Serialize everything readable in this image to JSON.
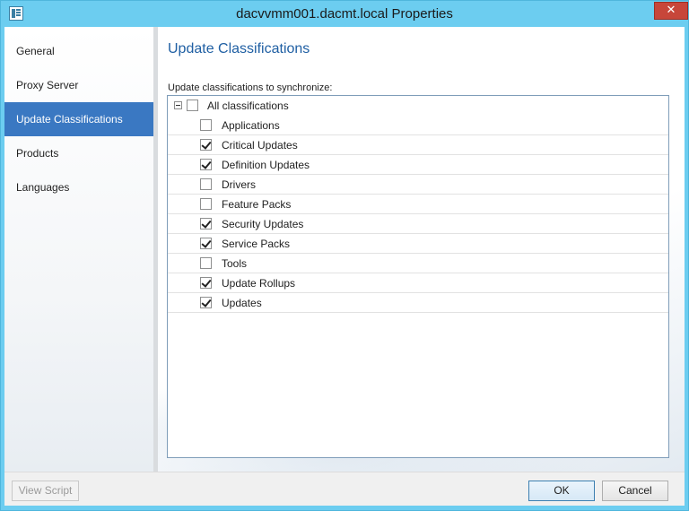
{
  "window": {
    "title": "dacvvmm001.dacmt.local Properties",
    "close_glyph": "✕"
  },
  "nav": {
    "items": [
      {
        "label": "General",
        "selected": false
      },
      {
        "label": "Proxy Server",
        "selected": false
      },
      {
        "label": "Update Classifications",
        "selected": true
      },
      {
        "label": "Products",
        "selected": false
      },
      {
        "label": "Languages",
        "selected": false
      }
    ]
  },
  "main": {
    "title": "Update Classifications",
    "list_label": "Update classifications to synchronize:",
    "root": {
      "label": "All classifications",
      "checked": false,
      "expanded": true
    },
    "classifications": [
      {
        "label": "Applications",
        "checked": false
      },
      {
        "label": "Critical Updates",
        "checked": true
      },
      {
        "label": "Definition Updates",
        "checked": true
      },
      {
        "label": "Drivers",
        "checked": false
      },
      {
        "label": "Feature Packs",
        "checked": false
      },
      {
        "label": "Security Updates",
        "checked": true
      },
      {
        "label": "Service Packs",
        "checked": true
      },
      {
        "label": "Tools",
        "checked": false
      },
      {
        "label": "Update Rollups",
        "checked": true
      },
      {
        "label": "Updates",
        "checked": true
      }
    ]
  },
  "footer": {
    "view_script_label": "View Script",
    "ok_label": "OK",
    "cancel_label": "Cancel"
  },
  "colors": {
    "titlebar": "#6ccdf0",
    "accent": "#3a78c2",
    "page_title": "#1f5fa3",
    "close": "#c7463a"
  }
}
